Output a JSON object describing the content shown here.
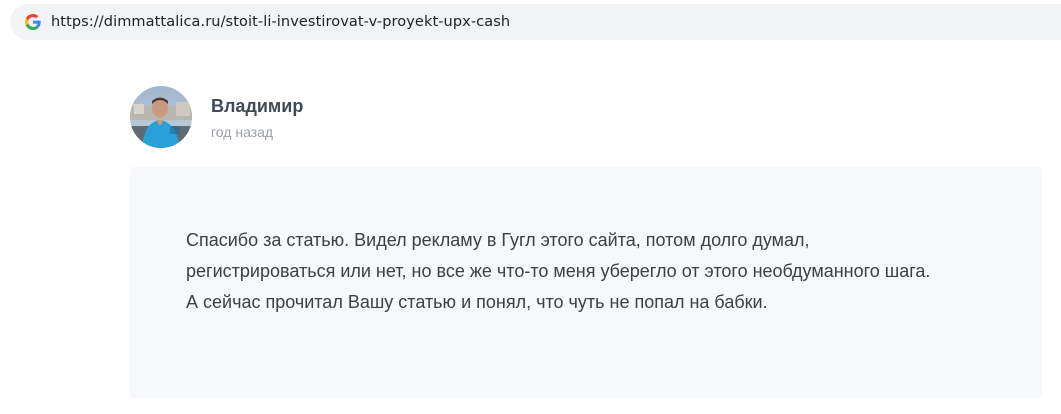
{
  "browser": {
    "url": "https://dimmattalica.ru/stoit-li-investirovat-v-proyekt-upx-cash",
    "site_icon": "google-g-icon"
  },
  "comment": {
    "author": "Владимир",
    "date": "год назад",
    "avatar_icon": "user-avatar-photo",
    "text": "Спасибо за статью. Видел рекламу в Гугл этого сайта, потом долго думал, регистрироваться или нет, но все же что-то меня уберегло от этого необдуманного шага. А сейчас прочитал Вашу статью и понял, что чуть не попал на бабки."
  },
  "colors": {
    "address_bar_bg": "#f1f3f4",
    "comment_bg": "#f6f8fb",
    "author_color": "#3f4a55",
    "date_color": "#9aa1a8",
    "text_color": "#3a4047"
  }
}
